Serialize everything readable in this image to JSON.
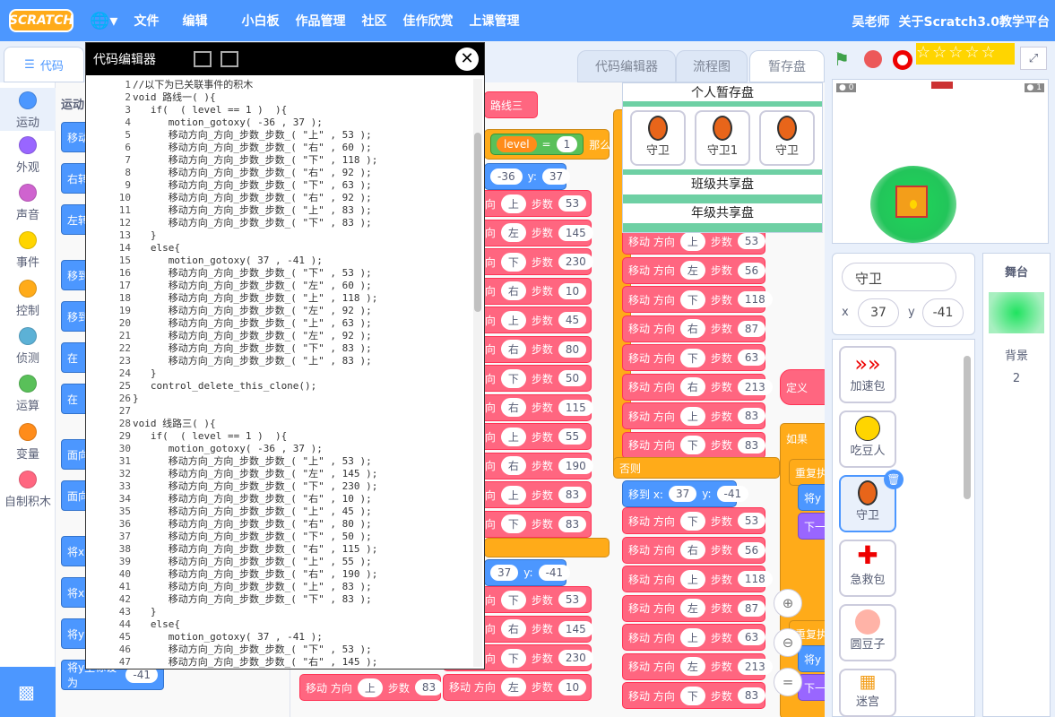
{
  "menubar": {
    "logo": "SCRATCH",
    "items": [
      "文件",
      "编辑",
      "小白板",
      "作品管理",
      "社区",
      "佳作欣赏",
      "上课管理"
    ],
    "user": "吴老师",
    "about": "关于Scratch3.0教学平台"
  },
  "tabs": {
    "code": "代码",
    "editor": "代码编辑器",
    "flow": "流程图",
    "stash": "暂存盘"
  },
  "categories": [
    {
      "label": "运动",
      "color": "#4c97ff"
    },
    {
      "label": "外观",
      "color": "#9966ff"
    },
    {
      "label": "声音",
      "color": "#cf63cf"
    },
    {
      "label": "事件",
      "color": "#ffd500"
    },
    {
      "label": "控制",
      "color": "#ffab19"
    },
    {
      "label": "侦测",
      "color": "#5cb1d6"
    },
    {
      "label": "运算",
      "color": "#59c059"
    },
    {
      "label": "变量",
      "color": "#ff8c1a"
    },
    {
      "label": "自制积木",
      "color": "#ff6680"
    }
  ],
  "palette": {
    "title": "运动",
    "blocks": [
      "移动",
      "右转",
      "左转",
      "移到",
      "移到",
      "在",
      "在",
      "面向",
      "面向",
      "将x",
      "将x",
      "将y",
      "将y坐标设为"
    ],
    "value": "-41"
  },
  "code_editor": {
    "title": "代码编辑器",
    "lines": [
      {
        "n": "1",
        "t": "//以下为已关联事件的积木"
      },
      {
        "n": "2",
        "t": "void 路线一( ){"
      },
      {
        "n": "3",
        "t": "   if(  ( level == 1 )  ){"
      },
      {
        "n": "4",
        "t": "      motion_gotoxy( -36 , 37 );"
      },
      {
        "n": "5",
        "t": "      移动方向_方向_步数_步数_( \"上\" , 53 );"
      },
      {
        "n": "6",
        "t": "      移动方向_方向_步数_步数_( \"右\" , 60 );"
      },
      {
        "n": "7",
        "t": "      移动方向_方向_步数_步数_( \"下\" , 118 );"
      },
      {
        "n": "8",
        "t": "      移动方向_方向_步数_步数_( \"右\" , 92 );"
      },
      {
        "n": "9",
        "t": "      移动方向_方向_步数_步数_( \"下\" , 63 );"
      },
      {
        "n": "10",
        "t": "      移动方向_方向_步数_步数_( \"右\" , 92 );"
      },
      {
        "n": "11",
        "t": "      移动方向_方向_步数_步数_( \"上\" , 83 );"
      },
      {
        "n": "12",
        "t": "      移动方向_方向_步数_步数_( \"下\" , 83 );"
      },
      {
        "n": "13",
        "t": "   }"
      },
      {
        "n": "14",
        "t": "   else{"
      },
      {
        "n": "15",
        "t": "      motion_gotoxy( 37 , -41 );"
      },
      {
        "n": "16",
        "t": "      移动方向_方向_步数_步数_( \"下\" , 53 );"
      },
      {
        "n": "17",
        "t": "      移动方向_方向_步数_步数_( \"左\" , 60 );"
      },
      {
        "n": "18",
        "t": "      移动方向_方向_步数_步数_( \"上\" , 118 );"
      },
      {
        "n": "19",
        "t": "      移动方向_方向_步数_步数_( \"左\" , 92 );"
      },
      {
        "n": "20",
        "t": "      移动方向_方向_步数_步数_( \"上\" , 63 );"
      },
      {
        "n": "21",
        "t": "      移动方向_方向_步数_步数_( \"左\" , 92 );"
      },
      {
        "n": "22",
        "t": "      移动方向_方向_步数_步数_( \"下\" , 83 );"
      },
      {
        "n": "23",
        "t": "      移动方向_方向_步数_步数_( \"上\" , 83 );"
      },
      {
        "n": "24",
        "t": "   }"
      },
      {
        "n": "25",
        "t": "   control_delete_this_clone();"
      },
      {
        "n": "26",
        "t": "}"
      },
      {
        "n": "27",
        "t": ""
      },
      {
        "n": "28",
        "t": "void 线路三( ){"
      },
      {
        "n": "29",
        "t": "   if(  ( level == 1 )  ){"
      },
      {
        "n": "30",
        "t": "      motion_gotoxy( -36 , 37 );"
      },
      {
        "n": "31",
        "t": "      移动方向_方向_步数_步数_( \"上\" , 53 );"
      },
      {
        "n": "32",
        "t": "      移动方向_方向_步数_步数_( \"左\" , 145 );"
      },
      {
        "n": "33",
        "t": "      移动方向_方向_步数_步数_( \"下\" , 230 );"
      },
      {
        "n": "34",
        "t": "      移动方向_方向_步数_步数_( \"右\" , 10 );"
      },
      {
        "n": "35",
        "t": "      移动方向_方向_步数_步数_( \"上\" , 45 );"
      },
      {
        "n": "36",
        "t": "      移动方向_方向_步数_步数_( \"右\" , 80 );"
      },
      {
        "n": "37",
        "t": "      移动方向_方向_步数_步数_( \"下\" , 50 );"
      },
      {
        "n": "38",
        "t": "      移动方向_方向_步数_步数_( \"右\" , 115 );"
      },
      {
        "n": "39",
        "t": "      移动方向_方向_步数_步数_( \"上\" , 55 );"
      },
      {
        "n": "40",
        "t": "      移动方向_方向_步数_步数_( \"右\" , 190 );"
      },
      {
        "n": "41",
        "t": "      移动方向_方向_步数_步数_( \"上\" , 83 );"
      },
      {
        "n": "42",
        "t": "      移动方向_方向_步数_步数_( \"下\" , 83 );"
      },
      {
        "n": "43",
        "t": "   }"
      },
      {
        "n": "44",
        "t": "   else{"
      },
      {
        "n": "45",
        "t": "      motion_gotoxy( 37 , -41 );"
      },
      {
        "n": "46",
        "t": "      移动方向_方向_步数_步数_( \"下\" , 53 );"
      },
      {
        "n": "47",
        "t": "      移动方向_方向_步数_步数_( \"右\" , 145 );"
      }
    ]
  },
  "workspace": {
    "move_label": "移动 方向",
    "steps_label": "步数",
    "else_label": "否则",
    "then_label": "那么",
    "if_label": "如果",
    "repeat_label": "重复执",
    "define_label": "定义",
    "goto_label": "移到 x:",
    "y_label": "y:",
    "level_var": "level",
    "eq": "=",
    "level_val": "1",
    "route_label": "路线三",
    "colA": [
      [
        "上",
        "53"
      ],
      [
        "左",
        "145"
      ],
      [
        "下",
        "230"
      ],
      [
        "右",
        "10"
      ],
      [
        "上",
        "45"
      ],
      [
        "右",
        "80"
      ],
      [
        "下",
        "50"
      ],
      [
        "右",
        "115"
      ],
      [
        "上",
        "55"
      ],
      [
        "右",
        "190"
      ],
      [
        "上",
        "83"
      ],
      [
        "下",
        "83"
      ]
    ],
    "colA_goto": [
      "-36",
      "37"
    ],
    "colA2_goto": [
      "37",
      "-41"
    ],
    "colA2": [
      [
        "下",
        "53"
      ],
      [
        "右",
        "145"
      ],
      [
        "下",
        "230"
      ],
      [
        "左",
        "10"
      ]
    ],
    "colA_bottom": [
      "上",
      "83"
    ],
    "colB": [
      [
        "上",
        "53"
      ],
      [
        "左",
        "56"
      ],
      [
        "下",
        "118"
      ],
      [
        "右",
        "87"
      ],
      [
        "下",
        "63"
      ],
      [
        "右",
        "213"
      ],
      [
        "上",
        "83"
      ],
      [
        "下",
        "83"
      ]
    ],
    "colB_goto": [
      "37",
      "-41"
    ],
    "colB2": [
      [
        "下",
        "53"
      ],
      [
        "右",
        "56"
      ],
      [
        "上",
        "118"
      ],
      [
        "左",
        "87"
      ],
      [
        "上",
        "63"
      ],
      [
        "左",
        "213"
      ],
      [
        "下",
        "83"
      ]
    ],
    "frag1": "将y",
    "frag2": "下一"
  },
  "stash": {
    "personal": "个人暂存盘",
    "items": [
      "守卫",
      "守卫1",
      "守卫"
    ],
    "class": "班级共享盘",
    "grade": "年级共享盘"
  },
  "sprite_info": {
    "name": "守卫",
    "x_label": "x",
    "x": "37",
    "y_label": "y",
    "y": "-41"
  },
  "stage_panel": {
    "title": "舞台",
    "backdrop_label": "背景",
    "backdrop_count": "2"
  },
  "sprites": [
    "加速包",
    "吃豆人",
    "守卫",
    "急救包",
    "圆豆子",
    "迷宫"
  ],
  "stage_hud": {
    "left": "0",
    "right": "1"
  },
  "colors": {
    "accent": "#4c97ff",
    "motion": "#4c97ff",
    "custom": "#ff6680",
    "control": "#ffab19",
    "stash_bar": "#6ed0a4"
  }
}
